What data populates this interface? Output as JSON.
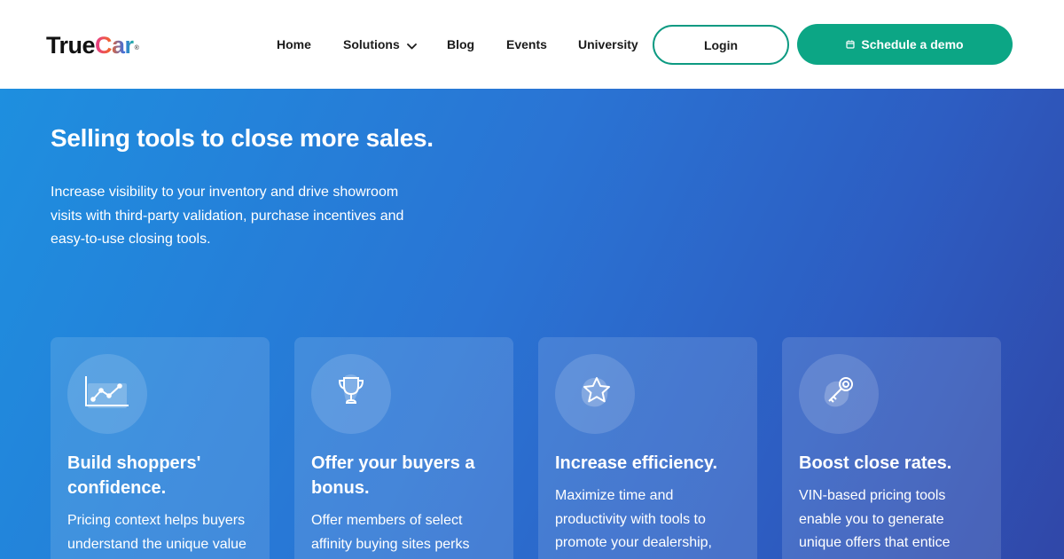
{
  "header": {
    "logo": {
      "part1": "True",
      "part2": "Car",
      "mark": "®"
    },
    "nav": {
      "home": "Home",
      "solutions": "Solutions",
      "blog": "Blog",
      "events": "Events",
      "university": "University"
    },
    "login_label": "Login",
    "demo_label": "Schedule a demo"
  },
  "hero": {
    "title": "Selling tools to close more sales.",
    "description": "Increase visibility to your inventory and drive showroom visits with third-party validation, purchase incentives and easy-to-use closing tools."
  },
  "cards": [
    {
      "icon": "chart-icon",
      "title": "Build shoppers' confidence.",
      "text": "Pricing context helps buyers understand the unique value"
    },
    {
      "icon": "trophy-icon",
      "title": "Offer your buyers a bonus.",
      "text": "Offer members of select affinity buying sites perks"
    },
    {
      "icon": "star-icon",
      "title": "Increase efficiency.",
      "text": "Maximize time and productivity with tools to promote your dealership,"
    },
    {
      "icon": "key-icon",
      "title": "Boost close rates.",
      "text": "VIN-based pricing tools enable you to generate unique offers that entice"
    }
  ],
  "colors": {
    "accent": "#0ca685",
    "hero_start": "#1e8fdf",
    "hero_end": "#3047a8"
  }
}
